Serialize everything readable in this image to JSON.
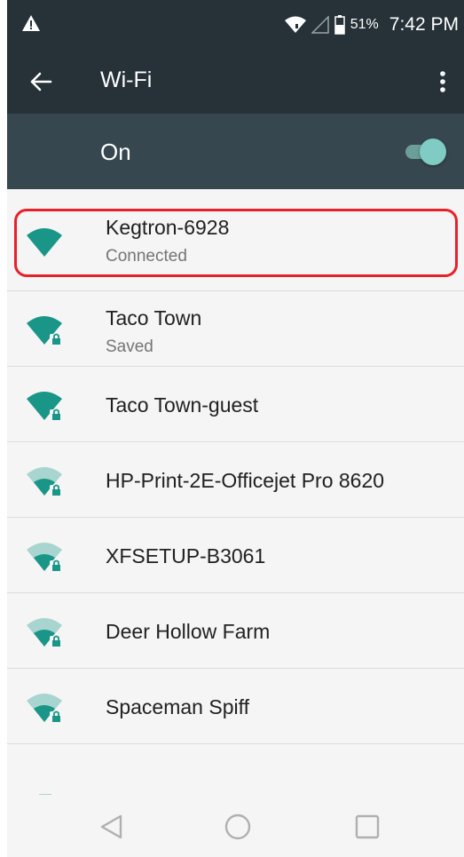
{
  "status_bar": {
    "battery_percent": "51%",
    "time": "7:42 PM",
    "icons": [
      "warning-icon",
      "wifi-signal-icon",
      "cell-signal-icon",
      "battery-icon"
    ]
  },
  "toolbar": {
    "back_icon": "arrow-back-icon",
    "title": "Wi-Fi",
    "menu_icon": "more-vert-icon"
  },
  "wifi_switch": {
    "label": "On",
    "enabled": true
  },
  "networks": [
    {
      "name": "Kegtron-6928",
      "status": "Connected",
      "locked": false,
      "strength": "strong",
      "highlighted": true
    },
    {
      "name": "Taco Town",
      "status": "Saved",
      "locked": true,
      "strength": "strong",
      "highlighted": false
    },
    {
      "name": "Taco Town-guest",
      "status": "",
      "locked": true,
      "strength": "strong",
      "highlighted": false
    },
    {
      "name": "HP-Print-2E-Officejet Pro 8620",
      "status": "",
      "locked": true,
      "strength": "weak",
      "highlighted": false
    },
    {
      "name": "XFSETUP-B3061",
      "status": "",
      "locked": true,
      "strength": "weak",
      "highlighted": false
    },
    {
      "name": "Deer Hollow Farm",
      "status": "",
      "locked": true,
      "strength": "weak",
      "highlighted": false
    },
    {
      "name": "Spaceman Spiff",
      "status": "",
      "locked": true,
      "strength": "weak",
      "highlighted": false
    }
  ],
  "nav_bar": {
    "buttons": [
      "back-triangle-icon",
      "home-circle-icon",
      "recents-square-icon"
    ]
  },
  "colors": {
    "header_dark": "#263238",
    "switch_bar": "#37474f",
    "accent_teal": "#1a9688",
    "highlight_red": "#e8202a"
  }
}
